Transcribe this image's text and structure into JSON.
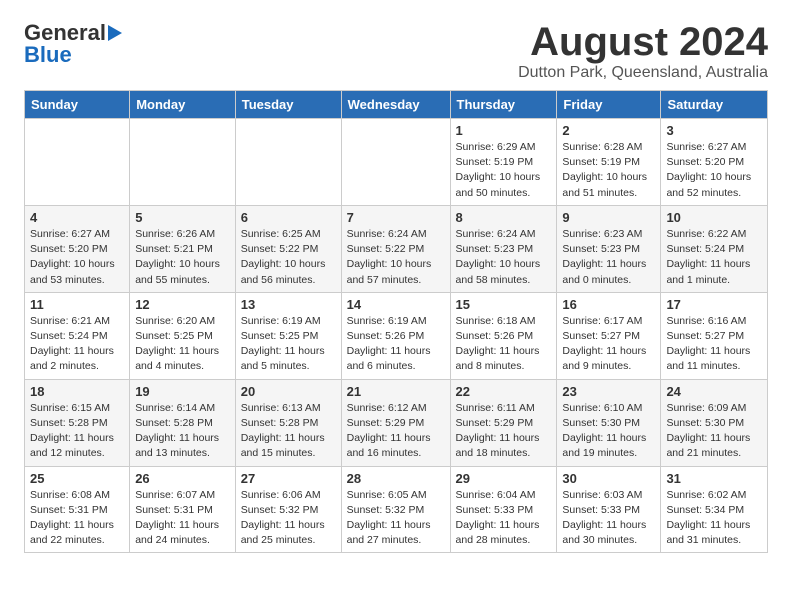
{
  "logo": {
    "general": "General",
    "blue": "Blue"
  },
  "title": "August 2024",
  "location": "Dutton Park, Queensland, Australia",
  "days_of_week": [
    "Sunday",
    "Monday",
    "Tuesday",
    "Wednesday",
    "Thursday",
    "Friday",
    "Saturday"
  ],
  "weeks": [
    [
      {
        "day": "",
        "sunrise": "",
        "sunset": "",
        "daylight": ""
      },
      {
        "day": "",
        "sunrise": "",
        "sunset": "",
        "daylight": ""
      },
      {
        "day": "",
        "sunrise": "",
        "sunset": "",
        "daylight": ""
      },
      {
        "day": "",
        "sunrise": "",
        "sunset": "",
        "daylight": ""
      },
      {
        "day": "1",
        "sunrise": "Sunrise: 6:29 AM",
        "sunset": "Sunset: 5:19 PM",
        "daylight": "Daylight: 10 hours and 50 minutes."
      },
      {
        "day": "2",
        "sunrise": "Sunrise: 6:28 AM",
        "sunset": "Sunset: 5:19 PM",
        "daylight": "Daylight: 10 hours and 51 minutes."
      },
      {
        "day": "3",
        "sunrise": "Sunrise: 6:27 AM",
        "sunset": "Sunset: 5:20 PM",
        "daylight": "Daylight: 10 hours and 52 minutes."
      }
    ],
    [
      {
        "day": "4",
        "sunrise": "Sunrise: 6:27 AM",
        "sunset": "Sunset: 5:20 PM",
        "daylight": "Daylight: 10 hours and 53 minutes."
      },
      {
        "day": "5",
        "sunrise": "Sunrise: 6:26 AM",
        "sunset": "Sunset: 5:21 PM",
        "daylight": "Daylight: 10 hours and 55 minutes."
      },
      {
        "day": "6",
        "sunrise": "Sunrise: 6:25 AM",
        "sunset": "Sunset: 5:22 PM",
        "daylight": "Daylight: 10 hours and 56 minutes."
      },
      {
        "day": "7",
        "sunrise": "Sunrise: 6:24 AM",
        "sunset": "Sunset: 5:22 PM",
        "daylight": "Daylight: 10 hours and 57 minutes."
      },
      {
        "day": "8",
        "sunrise": "Sunrise: 6:24 AM",
        "sunset": "Sunset: 5:23 PM",
        "daylight": "Daylight: 10 hours and 58 minutes."
      },
      {
        "day": "9",
        "sunrise": "Sunrise: 6:23 AM",
        "sunset": "Sunset: 5:23 PM",
        "daylight": "Daylight: 11 hours and 0 minutes."
      },
      {
        "day": "10",
        "sunrise": "Sunrise: 6:22 AM",
        "sunset": "Sunset: 5:24 PM",
        "daylight": "Daylight: 11 hours and 1 minute."
      }
    ],
    [
      {
        "day": "11",
        "sunrise": "Sunrise: 6:21 AM",
        "sunset": "Sunset: 5:24 PM",
        "daylight": "Daylight: 11 hours and 2 minutes."
      },
      {
        "day": "12",
        "sunrise": "Sunrise: 6:20 AM",
        "sunset": "Sunset: 5:25 PM",
        "daylight": "Daylight: 11 hours and 4 minutes."
      },
      {
        "day": "13",
        "sunrise": "Sunrise: 6:19 AM",
        "sunset": "Sunset: 5:25 PM",
        "daylight": "Daylight: 11 hours and 5 minutes."
      },
      {
        "day": "14",
        "sunrise": "Sunrise: 6:19 AM",
        "sunset": "Sunset: 5:26 PM",
        "daylight": "Daylight: 11 hours and 6 minutes."
      },
      {
        "day": "15",
        "sunrise": "Sunrise: 6:18 AM",
        "sunset": "Sunset: 5:26 PM",
        "daylight": "Daylight: 11 hours and 8 minutes."
      },
      {
        "day": "16",
        "sunrise": "Sunrise: 6:17 AM",
        "sunset": "Sunset: 5:27 PM",
        "daylight": "Daylight: 11 hours and 9 minutes."
      },
      {
        "day": "17",
        "sunrise": "Sunrise: 6:16 AM",
        "sunset": "Sunset: 5:27 PM",
        "daylight": "Daylight: 11 hours and 11 minutes."
      }
    ],
    [
      {
        "day": "18",
        "sunrise": "Sunrise: 6:15 AM",
        "sunset": "Sunset: 5:28 PM",
        "daylight": "Daylight: 11 hours and 12 minutes."
      },
      {
        "day": "19",
        "sunrise": "Sunrise: 6:14 AM",
        "sunset": "Sunset: 5:28 PM",
        "daylight": "Daylight: 11 hours and 13 minutes."
      },
      {
        "day": "20",
        "sunrise": "Sunrise: 6:13 AM",
        "sunset": "Sunset: 5:28 PM",
        "daylight": "Daylight: 11 hours and 15 minutes."
      },
      {
        "day": "21",
        "sunrise": "Sunrise: 6:12 AM",
        "sunset": "Sunset: 5:29 PM",
        "daylight": "Daylight: 11 hours and 16 minutes."
      },
      {
        "day": "22",
        "sunrise": "Sunrise: 6:11 AM",
        "sunset": "Sunset: 5:29 PM",
        "daylight": "Daylight: 11 hours and 18 minutes."
      },
      {
        "day": "23",
        "sunrise": "Sunrise: 6:10 AM",
        "sunset": "Sunset: 5:30 PM",
        "daylight": "Daylight: 11 hours and 19 minutes."
      },
      {
        "day": "24",
        "sunrise": "Sunrise: 6:09 AM",
        "sunset": "Sunset: 5:30 PM",
        "daylight": "Daylight: 11 hours and 21 minutes."
      }
    ],
    [
      {
        "day": "25",
        "sunrise": "Sunrise: 6:08 AM",
        "sunset": "Sunset: 5:31 PM",
        "daylight": "Daylight: 11 hours and 22 minutes."
      },
      {
        "day": "26",
        "sunrise": "Sunrise: 6:07 AM",
        "sunset": "Sunset: 5:31 PM",
        "daylight": "Daylight: 11 hours and 24 minutes."
      },
      {
        "day": "27",
        "sunrise": "Sunrise: 6:06 AM",
        "sunset": "Sunset: 5:32 PM",
        "daylight": "Daylight: 11 hours and 25 minutes."
      },
      {
        "day": "28",
        "sunrise": "Sunrise: 6:05 AM",
        "sunset": "Sunset: 5:32 PM",
        "daylight": "Daylight: 11 hours and 27 minutes."
      },
      {
        "day": "29",
        "sunrise": "Sunrise: 6:04 AM",
        "sunset": "Sunset: 5:33 PM",
        "daylight": "Daylight: 11 hours and 28 minutes."
      },
      {
        "day": "30",
        "sunrise": "Sunrise: 6:03 AM",
        "sunset": "Sunset: 5:33 PM",
        "daylight": "Daylight: 11 hours and 30 minutes."
      },
      {
        "day": "31",
        "sunrise": "Sunrise: 6:02 AM",
        "sunset": "Sunset: 5:34 PM",
        "daylight": "Daylight: 11 hours and 31 minutes."
      }
    ]
  ]
}
